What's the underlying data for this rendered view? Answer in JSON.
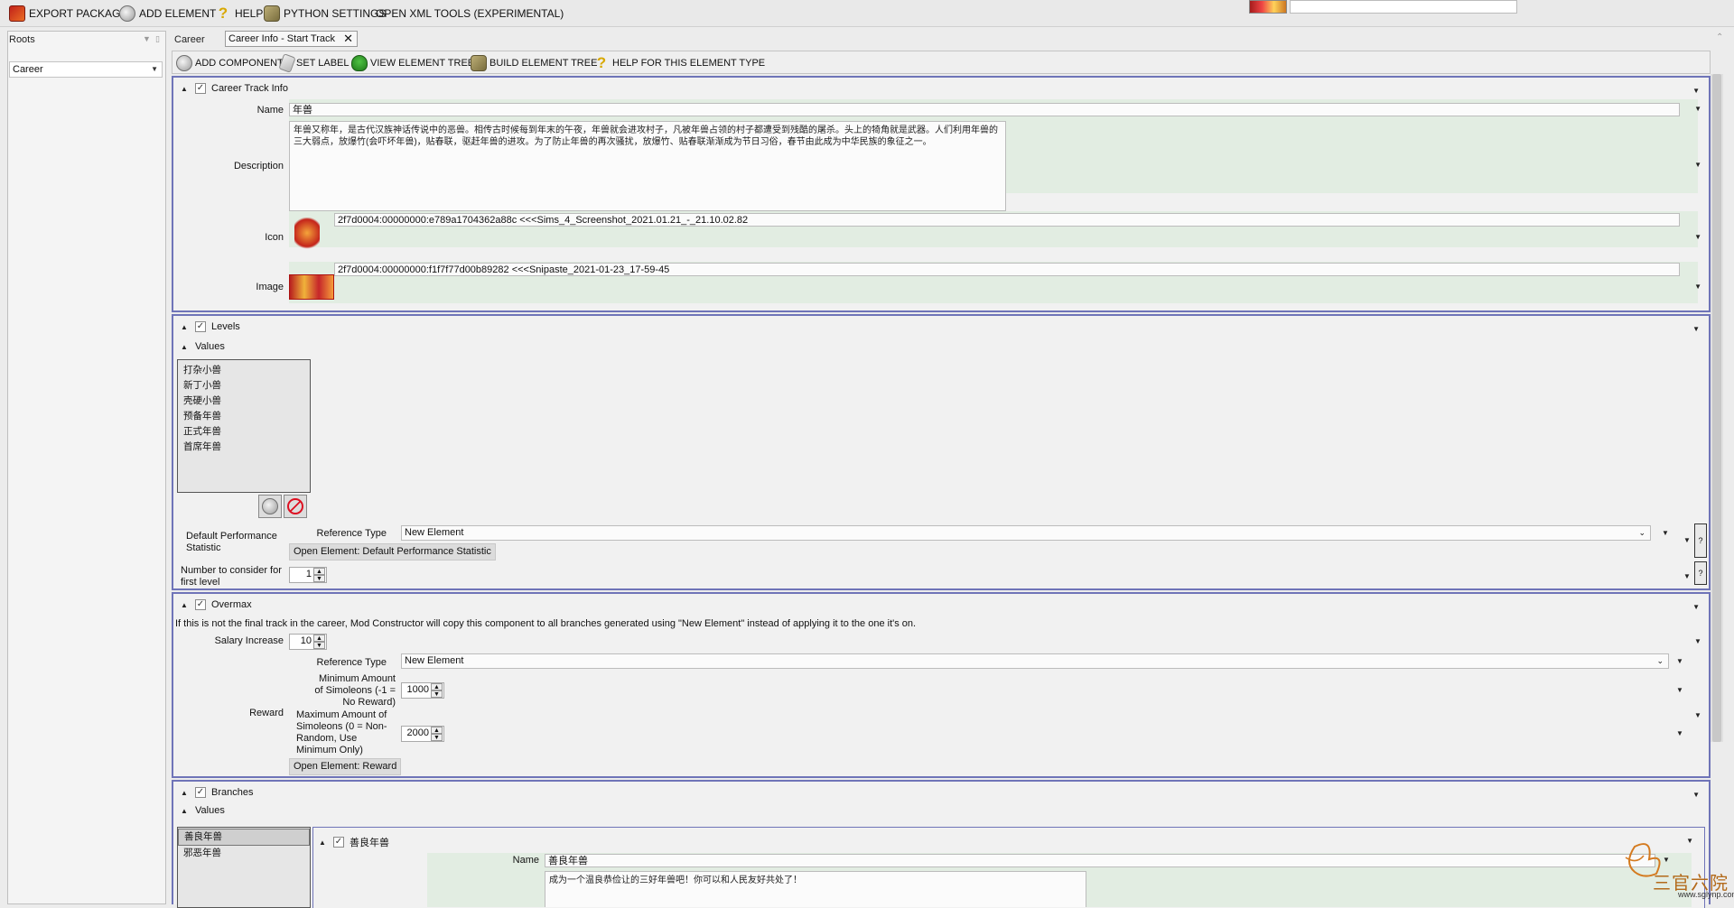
{
  "menu": {
    "export_package": "EXPORT PACKAGE",
    "add_element": "ADD ELEMENT",
    "help": "HELP",
    "python_settings": "PYTHON SETTINGS",
    "open_xml_tools": "OPEN XML TOOLS (EXPERIMENTAL)"
  },
  "left_panel": {
    "roots_label": "Roots",
    "career_value": "Career"
  },
  "breadcrumb": {
    "root": "Career",
    "tab_label": "Career Info - Start Track"
  },
  "toolbar": {
    "add_component": "ADD COMPONENT",
    "set_label": "SET LABEL",
    "view_element_tree": "VIEW ELEMENT TREE",
    "build_element_tree": "BUILD ELEMENT TREE",
    "help_element_type": "HELP FOR THIS ELEMENT TYPE"
  },
  "career_track_info": {
    "title": "Career Track Info",
    "name_label": "Name",
    "name_value": "年兽",
    "description_label": "Description",
    "description_value": "年兽又称年，是古代汉族神话传说中的恶兽。相传古时候每到年末的午夜，年兽就会进攻村子，凡被年兽占领的村子都遭受到残酷的屠杀。头上的犄角就是武器。人们利用年兽的三大弱点，放爆竹(会吓坏年兽)，贴春联，驱赶年兽的进攻。为了防止年兽的再次骚扰，放爆竹、贴春联渐渐成为节日习俗，春节由此成为中华民族的象征之一。",
    "icon_label": "Icon",
    "icon_value": "2f7d0004:00000000:e789a1704362a88c <<<Sims_4_Screenshot_2021.01.21_-_21.10.02.82",
    "image_label": "Image",
    "image_value": "2f7d0004:00000000:f1f7f77d00b89282 <<<Snipaste_2021-01-23_17-59-45"
  },
  "levels": {
    "title": "Levels",
    "values_label": "Values",
    "items": [
      "打杂小兽",
      "新丁小兽",
      "壳硬小兽",
      "预备年兽",
      "正式年兽",
      "首席年兽"
    ],
    "default_perf_label": "Default Performance Statistic",
    "reference_type_label": "Reference Type",
    "reference_type_value": "New Element",
    "open_element_label": "Open Element: Default Performance Statistic",
    "number_consider_label": "Number to consider for first level",
    "number_consider_value": "1",
    "q_mark": "?"
  },
  "overmax": {
    "title": "Overmax",
    "note": "If this is not the final track in the career, Mod Constructor will copy this component to all branches generated using \"New Element\" instead of applying it to the one it's on.",
    "salary_label": "Salary Increase",
    "salary_value": "10",
    "reference_type_label": "Reference Type",
    "reference_type_value": "New Element",
    "reward_label": "Reward",
    "min_label": "Minimum Amount of Simoleons (-1 = No Reward)",
    "min_value": "1000",
    "max_label": "Maximum Amount of Simoleons (0 = Non-Random, Use Minimum Only)",
    "max_value": "2000",
    "open_reward_label": "Open Element: Reward"
  },
  "branches": {
    "title": "Branches",
    "values_label": "Values",
    "items": [
      "善良年兽",
      "邪恶年兽"
    ],
    "sub_title": "善良年兽",
    "sub_name_label": "Name",
    "sub_name_value": "善良年兽",
    "sub_description_value": "成为一个温良恭俭让的三好年兽吧！你可以和人民友好共处了！"
  },
  "watermark": {
    "text": "三官六院",
    "url": "www.sglynp.com"
  },
  "colors": {
    "section_border": "#6f74b8",
    "green_row": "#e2ede2",
    "background": "#ececec"
  }
}
